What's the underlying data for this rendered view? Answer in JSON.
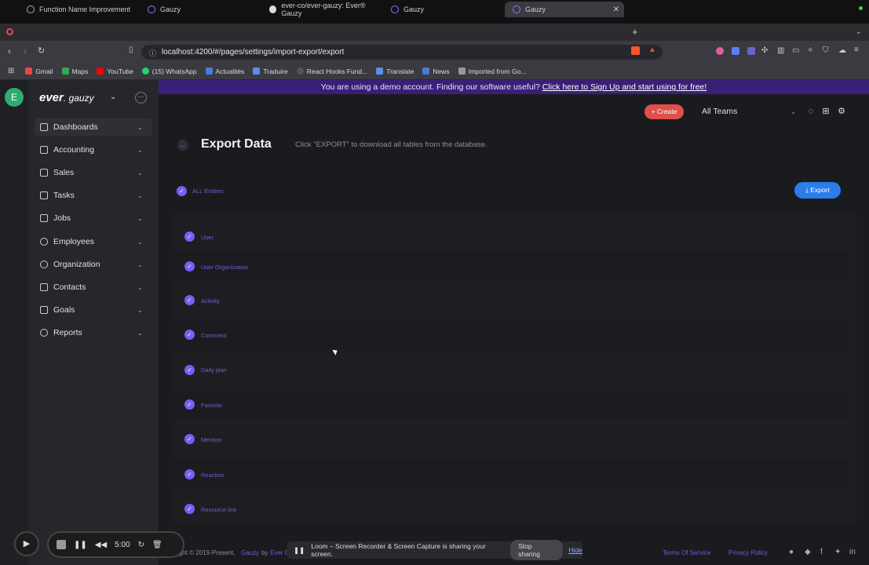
{
  "browser": {
    "tabs": [
      {
        "label": "Function Name Improvement",
        "icon": "globe-icon"
      },
      {
        "label": "Gauzy",
        "icon": "gauzy-icon"
      },
      {
        "label": "ever-co/ever-gauzy: Ever® Gauzy",
        "icon": "github-icon"
      },
      {
        "label": "Gauzy",
        "icon": "gauzy-icon"
      },
      {
        "label": "Gauzy",
        "icon": "gauzy-icon"
      }
    ],
    "url": "localhost:4200/#/pages/settings/import-export/export",
    "bookmarks": [
      "Gmail",
      "Maps",
      "YouTube",
      "(15) WhatsApp",
      "Actualités",
      "Traduire",
      "React Hooks Fund...",
      "Translate",
      "News",
      "Imported from Go..."
    ]
  },
  "app": {
    "avatar_letter": "E",
    "logo_bold": "ever",
    "logo_light": "gauzy",
    "demo_text": "You are using a demo account. Finding our software useful?",
    "demo_link": "Click here to Sign Up and start using for free!",
    "create_label": "+ Create",
    "team_select": "All Teams"
  },
  "sidebar": {
    "items": [
      {
        "label": "Dashboards"
      },
      {
        "label": "Accounting"
      },
      {
        "label": "Sales"
      },
      {
        "label": "Tasks"
      },
      {
        "label": "Jobs"
      },
      {
        "label": "Employees"
      },
      {
        "label": "Organization"
      },
      {
        "label": "Contacts"
      },
      {
        "label": "Goals"
      },
      {
        "label": "Reports"
      }
    ]
  },
  "page": {
    "title": "Export Data",
    "subtitle": "Click \"EXPORT\" to download all tables from the database.",
    "all_entities_label": "ALL Entities",
    "export_label": "Export",
    "entities": [
      "User",
      "User Organization",
      "Activity",
      "Comment",
      "Daily plan",
      "Favorite",
      "Mention",
      "Reaction",
      "Resource link"
    ]
  },
  "footer": {
    "copyright": "ight © 2019-Present,",
    "brand": "Gauzy",
    "by": "by",
    "org": "Ever C",
    "terms": "Terms Of Service",
    "privacy": "Privacy Policy"
  },
  "recorder": {
    "time": "5:00",
    "loom_text": "Loom – Screen Recorder & Screen Capture is sharing your screen.",
    "stop_sharing": "Stop sharing",
    "hide": "Hide"
  }
}
